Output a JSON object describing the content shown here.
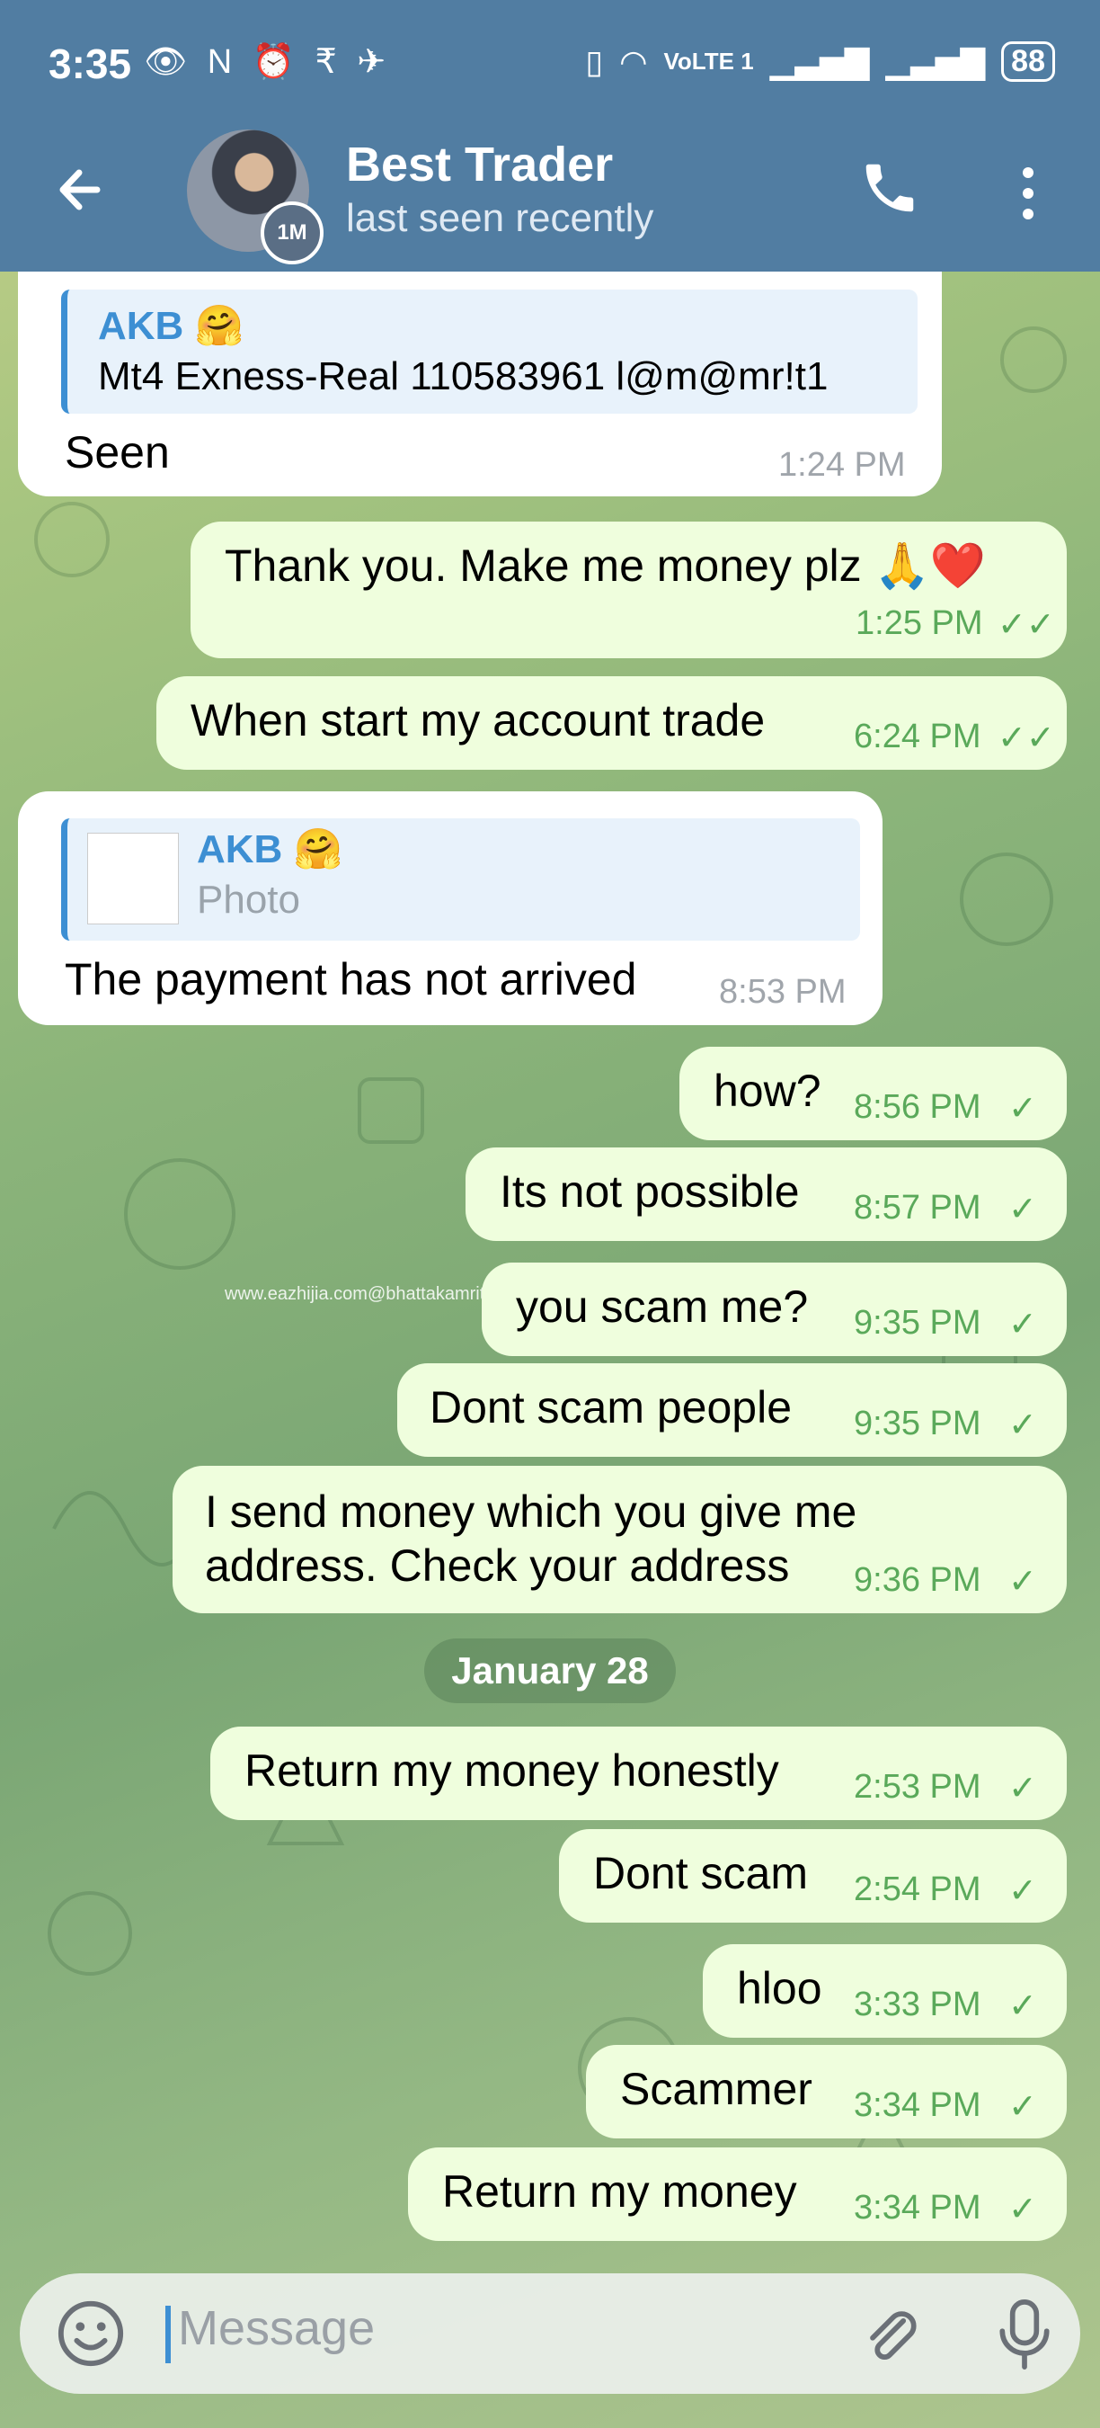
{
  "status_bar": {
    "time": "3:35",
    "left_icons": "👁 N ⏰ ₹ ✈",
    "network": "VoLTE 1",
    "battery": "88"
  },
  "header": {
    "back_icon": "arrow-left",
    "name": "Best Trader",
    "status": "last seen recently",
    "story_badge": "1M"
  },
  "messages": [
    {
      "dir": "in",
      "reply_name": "AKB 🤗",
      "reply_text": "Mt4 Exness-Real 110583961 l@m@mr!t1",
      "text": "Seen",
      "time": "1:24 PM"
    },
    {
      "dir": "out",
      "text": "Thank you. Make me money plz 🙏❤️",
      "time": "1:25 PM",
      "ticks": "✓✓"
    },
    {
      "dir": "out",
      "text": "When start my account trade",
      "time": "6:24 PM",
      "ticks": "✓✓"
    },
    {
      "dir": "in",
      "reply_name": "AKB 🤗",
      "reply_text": "Photo",
      "text": "The payment has not arrived",
      "time": "8:53 PM"
    },
    {
      "dir": "out",
      "text": "how?",
      "time": "8:56 PM",
      "ticks": "✓"
    },
    {
      "dir": "out",
      "text": "Its not possible",
      "time": "8:57 PM",
      "ticks": "✓"
    },
    {
      "dir": "out",
      "text": "you scam me?",
      "time": "9:35 PM",
      "ticks": "✓"
    },
    {
      "dir": "out",
      "text": "Dont scam people",
      "time": "9:35 PM",
      "ticks": "✓"
    },
    {
      "dir": "out",
      "text_line1": "I send money which you give me",
      "text_line2": "address. Check your address",
      "time": "9:36 PM",
      "ticks": "✓"
    },
    {
      "dir": "out",
      "text": "Return my money honestly",
      "time": "2:53 PM",
      "ticks": "✓"
    },
    {
      "dir": "out",
      "text": "Dont scam",
      "time": "2:54 PM",
      "ticks": "✓"
    },
    {
      "dir": "out",
      "text": "hloo",
      "time": "3:33 PM",
      "ticks": "✓"
    },
    {
      "dir": "out",
      "text": "Scammer",
      "time": "3:34 PM",
      "ticks": "✓"
    },
    {
      "dir": "out",
      "text": "Return my money",
      "time": "3:34 PM",
      "ticks": "✓"
    }
  ],
  "date_separator": "January 28",
  "watermark": "www.eazhijia.com@bhattakamrit",
  "composer": {
    "placeholder": "Message"
  },
  "colors": {
    "header": "#517da2",
    "outgoing": "#effedd",
    "incoming": "#ffffff",
    "accent": "#3d8fd3",
    "tick": "#5aa95a"
  }
}
